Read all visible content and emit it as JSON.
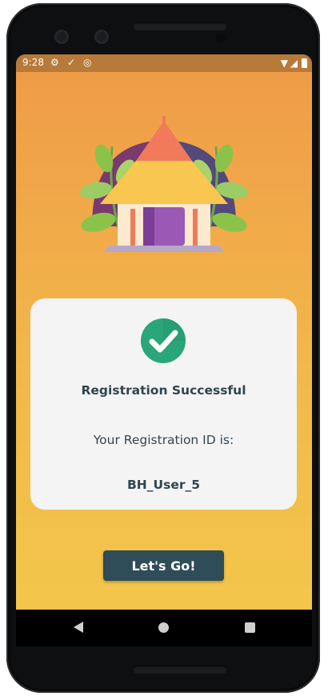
{
  "statusbar": {
    "time": "9:28",
    "icons": [
      "gear-icon",
      "checkmark-icon",
      "sync-icon",
      "wifi-icon",
      "signal-icon",
      "battery-icon"
    ]
  },
  "card": {
    "title": "Registration Successful",
    "subtitle": "Your Registration ID is:",
    "registration_id": "BH_User_5"
  },
  "action": {
    "go_label": "Let's Go!"
  },
  "colors": {
    "gradient_top": "#ef9a47",
    "gradient_bottom": "#f3c84a",
    "button": "#2f4c59",
    "check": "#2aa67a",
    "card": "#f4f4f5"
  },
  "navbar": [
    "back-icon",
    "home-icon",
    "recents-icon"
  ]
}
